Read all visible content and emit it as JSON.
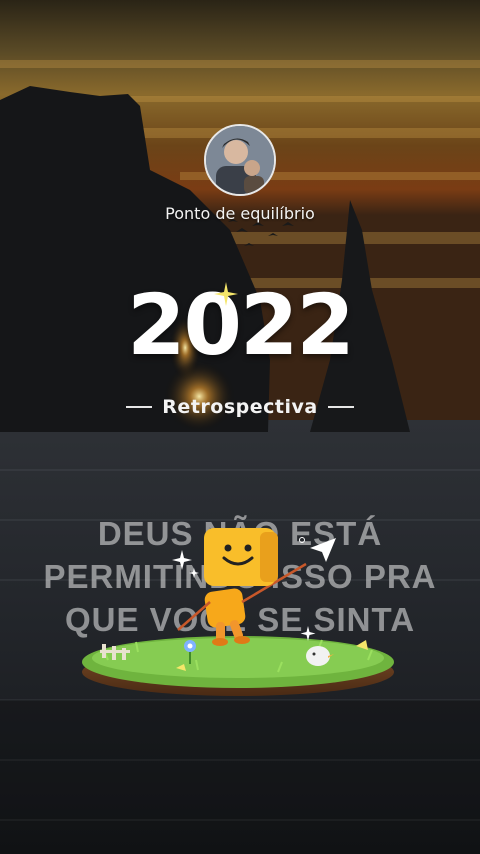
{
  "profile": {
    "name": "Ponto de equilíbrio"
  },
  "hero": {
    "year": "2022",
    "subtitle": "Retrospectiva"
  },
  "caption": {
    "lines": [
      "DEUS NÃO ESTÁ",
      "PERMITINDO ISSO PRA",
      "QUE VOCÊ SE SINTA"
    ]
  },
  "colors": {
    "accent_star": "#f5e66a",
    "mascot": "#f7b21f",
    "grass": "#7cc24a"
  }
}
